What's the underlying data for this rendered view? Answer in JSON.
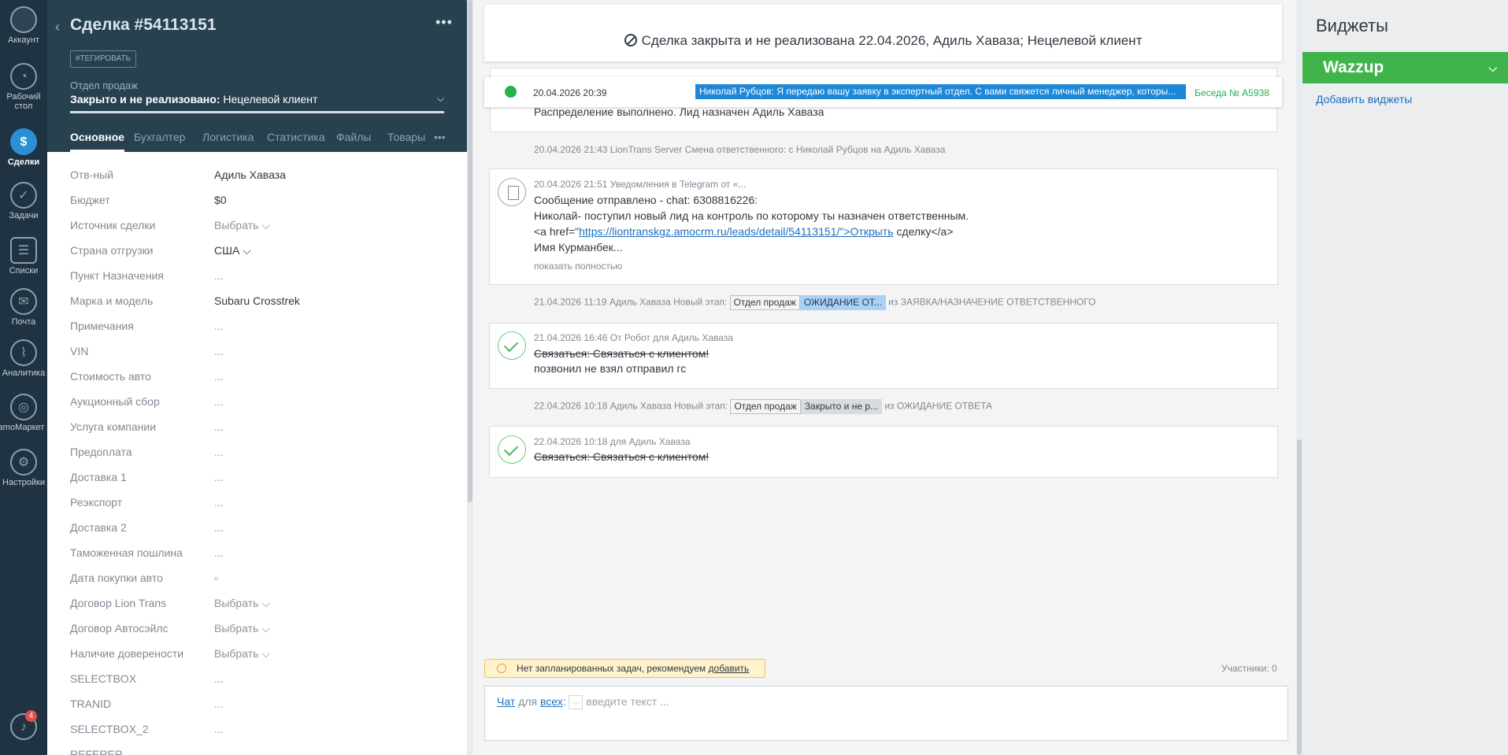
{
  "nav": {
    "items": [
      {
        "label": "Аккаунт",
        "icon": "account-icon",
        "glyph": ""
      },
      {
        "label": "Рабочий стол",
        "icon": "dashboard-icon",
        "glyph": "◔"
      },
      {
        "label": "Сделки",
        "icon": "deals-icon",
        "glyph": "$"
      },
      {
        "label": "Задачи",
        "icon": "tasks-icon",
        "glyph": "✓"
      },
      {
        "label": "Списки",
        "icon": "lists-icon",
        "glyph": "☰"
      },
      {
        "label": "Почта",
        "icon": "mail-icon",
        "glyph": "✉"
      },
      {
        "label": "Аналитика",
        "icon": "analytics-icon",
        "glyph": "⌇"
      },
      {
        "label": "amoМаркет",
        "icon": "market-icon",
        "glyph": "◎"
      },
      {
        "label": "Настройки",
        "icon": "settings-icon",
        "glyph": "⚙"
      }
    ],
    "notifications_count": "4"
  },
  "deal": {
    "title": "Сделка #54113151",
    "tag_button": "#ТЕГИРОВАТЬ",
    "pipeline": "Отдел продаж",
    "status_bold": "Закрыто и не реализовано:",
    "status_rest": " Нецелевой клиент",
    "tabs": [
      "Основное",
      "Бухгалтер",
      "Логистика",
      "Статистика",
      "Файлы",
      "Товары"
    ],
    "fields": [
      {
        "label": "Отв-ный",
        "value": "Адиль Хаваза"
      },
      {
        "label": "Бюджет",
        "value": "$0"
      },
      {
        "label": "Источник сделки",
        "value": "Выбрать ⌵"
      },
      {
        "label": "Страна отгрузки",
        "value": "США ⌵"
      },
      {
        "label": "Пункт Назначения",
        "value": "..."
      },
      {
        "label": "Марка и модель",
        "value": "Subaru Crosstrek"
      },
      {
        "label": "Примечания",
        "value": "..."
      },
      {
        "label": "VIN",
        "value": "..."
      },
      {
        "label": "Стоимость авто",
        "value": "..."
      },
      {
        "label": "Аукционный сбор",
        "value": "..."
      },
      {
        "label": "Услуга компании",
        "value": "..."
      },
      {
        "label": "Предоплата",
        "value": "..."
      },
      {
        "label": "Доставка 1",
        "value": "..."
      },
      {
        "label": "Реэкспорт",
        "value": "..."
      },
      {
        "label": "Доставка 2",
        "value": "..."
      },
      {
        "label": "Таможенная пошлина",
        "value": "..."
      },
      {
        "label": "Дата покупки авто",
        "value": "▫"
      },
      {
        "label": "Договор Lion Trans",
        "value": "Выбрать ⌵"
      },
      {
        "label": "Договор Автосэйлс",
        "value": "Выбрать ⌵"
      },
      {
        "label": "Наличие доверености",
        "value": "Выбрать ⌵"
      },
      {
        "label": "SELECTBOX",
        "value": "..."
      },
      {
        "label": "TRANID",
        "value": "..."
      },
      {
        "label": "SELECTBOX_2",
        "value": "..."
      },
      {
        "label": "REFERER",
        "value": ""
      }
    ]
  },
  "feed": {
    "closed_banner": "Сделка закрыта и не реализована 22.04.2026, Адиль Хаваза; Нецелевой клиент",
    "whatsapp": {
      "time": "20.04.2026 20:39",
      "message": "Николай Рубцов: Я передаю вашу заявку в экспертный отдел. С вами свяжется личный менеджер, которы...",
      "conversation": "Беседа № A5938"
    },
    "distribution_text": "Распределение выполнено. Лид назначен Адиль Хаваза",
    "responsible_change": "20.04.2026 21:43 LionTrans Server Смена ответственного: с Николай Рубцов на Адиль Хаваза",
    "telegram": {
      "meta": "20.04.2026 21:51 Уведомления в Telegram от «...",
      "line1": "Сообщение отправлено - chat: 6308816226:",
      "line2": "Николай- поступил новый лид на контроль по которому ты назначен ответственным.",
      "line3_pre": "<a href=\"",
      "line3_link": "https://liontranskgz.amocrm.ru/leads/detail/54113151/\">Открыть",
      "line3_post": " сделку</a>",
      "line4": "Имя Курманбек...",
      "show_full": "показать полностью"
    },
    "stage1": {
      "prefix": "21.04.2026 11:19 Адиль Хаваза Новый этап:",
      "pipeline": "Отдел продаж",
      "stage": "ОЖИДАНИЕ ОТ...",
      "suffix": "из ЗАЯВКА/НАЗНАЧЕНИЕ ОТВЕТСТВЕННОГО"
    },
    "task1": {
      "meta": "21.04.2026 16:46  От Робот для Адиль Хаваза",
      "title": "Связаться: Связаться с клиентом!",
      "result": "позвонил не взял отправил гс"
    },
    "stage2": {
      "prefix": "22.04.2026 10:18 Адиль Хаваза Новый этап:",
      "pipeline": "Отдел продаж",
      "stage": "Закрыто и не р...",
      "suffix": "из ОЖИДАНИЕ ОТВЕТА"
    },
    "task2": {
      "meta": "22.04.2026 10:18  для Адиль Хаваза",
      "title": "Связаться: Связаться с клиентом!"
    },
    "no_tasks_text": "Нет запланированных задач, рекомендуем ",
    "no_tasks_link": "добавить",
    "participants": "Участники: 0",
    "composer": {
      "chat": "Чат",
      "for": " для ",
      "all": "всех",
      "colon": ":",
      "placeholder": "введите текст ..."
    }
  },
  "widgets": {
    "title": "Виджеты",
    "wazzup": "Wazzup",
    "add_link": "Добавить виджеты"
  },
  "colors": {
    "sidebar": "#1f3342",
    "deal_header": "#27414f",
    "accent_blue": "#1e88d8",
    "wazzup_green": "#3fb44b"
  }
}
